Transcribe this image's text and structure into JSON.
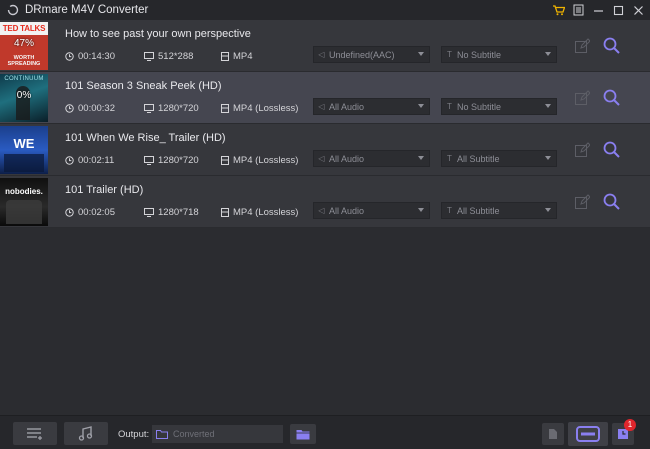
{
  "app": {
    "title": "DRmare M4V Converter"
  },
  "rows": [
    {
      "title": "How to see past your own perspective",
      "duration": "00:14:30",
      "resolution": "512*288",
      "format": "MP4",
      "audio": "Undefined(AAC)",
      "subtitle": "No Subtitle",
      "progress_label": "47%",
      "thumb_text": "TED TALKS",
      "thumb_subtext": "WORTH SPREADING",
      "selected": false
    },
    {
      "title": "101 Season 3 Sneak Peek (HD)",
      "duration": "00:00:32",
      "resolution": "1280*720",
      "format": "MP4 (Lossless)",
      "audio": "All Audio",
      "subtitle": "No Subtitle",
      "progress_label": "0%",
      "thumb_text": "CONTINUUM",
      "selected": true
    },
    {
      "title": "101 When We Rise_ Trailer (HD)",
      "duration": "00:02:11",
      "resolution": "1280*720",
      "format": "MP4 (Lossless)",
      "audio": "All Audio",
      "subtitle": "All Subtitle",
      "thumb_text": "WE",
      "selected": false
    },
    {
      "title": "101 Trailer (HD)",
      "duration": "00:02:05",
      "resolution": "1280*718",
      "format": "MP4 (Lossless)",
      "audio": "All Audio",
      "subtitle": "All Subtitle",
      "thumb_text": "nobodies.",
      "selected": false
    }
  ],
  "bottom": {
    "output_label": "Output:",
    "output_placeholder": "Converted",
    "history_badge": "1"
  },
  "colors": {
    "accent": "#8a7ff0",
    "badge": "#e0262d",
    "cart": "#f0b400"
  }
}
